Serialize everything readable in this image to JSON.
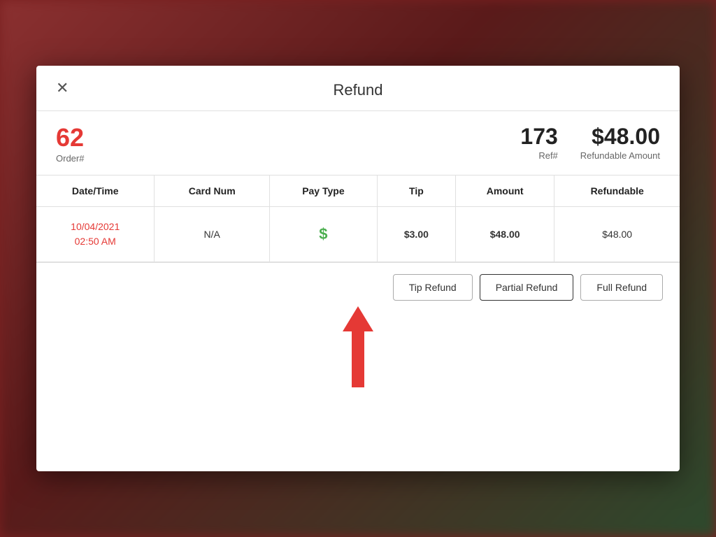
{
  "background": {
    "color": "#7a2020"
  },
  "modal": {
    "title": "Refund",
    "close_label": "✕"
  },
  "order_info": {
    "order_number": "62",
    "order_label": "Order#",
    "ref_number": "173",
    "ref_label": "Ref#",
    "refundable_amount": "$48.00",
    "refundable_label": "Refundable Amount"
  },
  "table": {
    "headers": [
      "Date/Time",
      "Card Num",
      "Pay Type",
      "Tip",
      "Amount",
      "Refundable"
    ],
    "rows": [
      {
        "date": "10/04/2021",
        "time": "02:50 AM",
        "card_num": "N/A",
        "pay_type_icon": "$",
        "tip": "$3.00",
        "amount": "$48.00",
        "refundable": "$48.00"
      }
    ]
  },
  "buttons": {
    "tip_refund": "Tip Refund",
    "partial_refund": "Partial Refund",
    "full_refund": "Full Refund"
  }
}
